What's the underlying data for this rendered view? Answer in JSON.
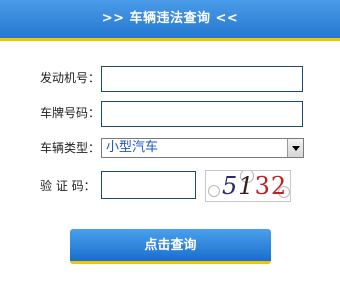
{
  "header": {
    "title": ">> 车辆违法查询  <<"
  },
  "form": {
    "engine_label": "发动机号：",
    "engine_value": "",
    "plate_label": "车牌号码：",
    "plate_value": "",
    "type_label": "车辆类型：",
    "type_selected": "小型汽车",
    "captcha_label": "验 证 码：",
    "captcha_value": "",
    "captcha_digits": [
      "5",
      "1",
      "3",
      "2"
    ]
  },
  "submit_label": "点击查询",
  "colors": {
    "header_blue": "#2f86dc",
    "accent_yellow": "#f5c400",
    "field_border": "#1c4a74",
    "select_text": "#1a56c8"
  }
}
